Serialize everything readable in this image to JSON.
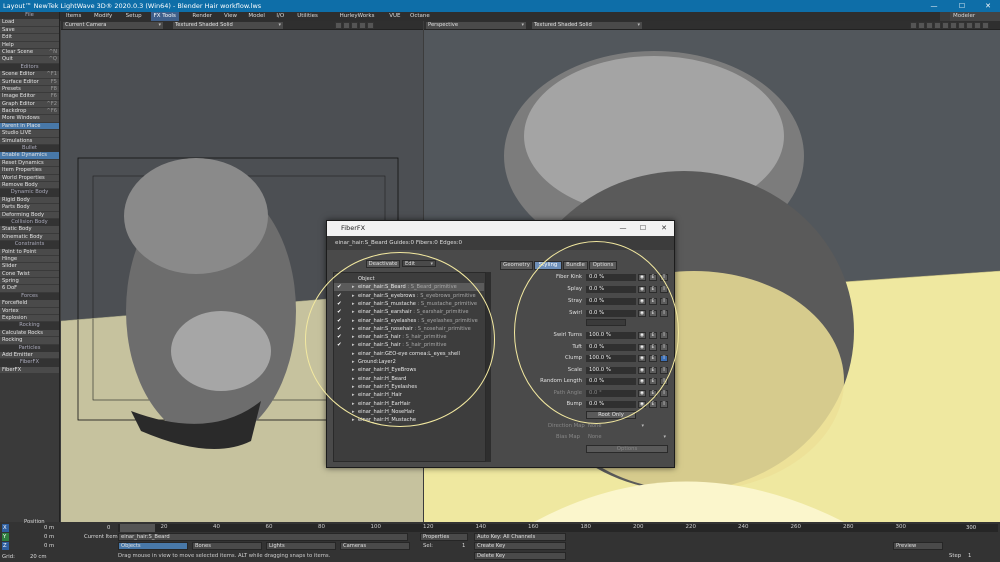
{
  "window": {
    "title": "Layout™ NewTek LightWave 3D® 2020.0.3 (Win64) - Blender Hair workflow.lws",
    "minimize": "—",
    "maximize": "☐",
    "close": "✕"
  },
  "menubar": {
    "items": [
      "Items",
      "Modify",
      "Setup",
      "FX Tools",
      "Render",
      "View",
      "Model",
      "I/O",
      "Utilities",
      "HurleyWorks",
      "VUE",
      "Octane"
    ],
    "active": "FX Tools",
    "modeler": "Modeler"
  },
  "sidebar": {
    "file_header": "File",
    "file_items": [
      {
        "label": "Load"
      },
      {
        "label": "Save"
      },
      {
        "label": "Edit"
      },
      {
        "label": "Help"
      }
    ],
    "clear_scene": {
      "label": "Clear Scene",
      "shortcut": "^N"
    },
    "quit": {
      "label": "Quit",
      "shortcut": "^Q"
    },
    "editors_header": "Editors",
    "editor_items": [
      {
        "label": "Scene Editor",
        "shortcut": "^F1"
      },
      {
        "label": "Surface Editor",
        "shortcut": "F5"
      },
      {
        "label": "Presets",
        "shortcut": "F8"
      },
      {
        "label": "Image Editor",
        "shortcut": "F6"
      },
      {
        "label": "Graph Editor",
        "shortcut": "^F2"
      },
      {
        "label": "Backdrop",
        "shortcut": "^F6"
      },
      {
        "label": "More Windows"
      }
    ],
    "extra_items": [
      {
        "label": "Parent in Place"
      },
      {
        "label": "Studio LIVE"
      },
      {
        "label": "Simulations"
      }
    ],
    "bullet_header": "Bullet",
    "bullet_items": [
      "Enable Dynamics",
      "Reset Dynamics",
      "Item Properties",
      "World Properties",
      "Remove Body"
    ],
    "dynamic_header": "Dynamic Body",
    "dynamic_items": [
      "Rigid Body",
      "Parts Body",
      "Deforming Body"
    ],
    "collision_header": "Collision Body",
    "collision_items": [
      "Static Body",
      "Kinematic Body"
    ],
    "constraints_header": "Constraints",
    "constraint_items": [
      "Point to Point",
      "Hinge",
      "Slider",
      "Cone Twist",
      "Spring",
      "6 DoF"
    ],
    "forces_header": "Forces",
    "force_items": [
      "Forcefield",
      "Vortex",
      "Explosion"
    ],
    "rocking_header": "Rocking",
    "rocking_items": [
      "Calculate Rocks",
      "Rocking"
    ],
    "particles_header": "Particles",
    "particle_items": [
      "Add Emitter"
    ],
    "fiberfx_header": "FiberFX",
    "fiberfx_items": [
      "FiberFX"
    ]
  },
  "viewport_left": {
    "camera": "Current Camera",
    "shading": "Textured Shaded Solid"
  },
  "viewport_right": {
    "view": "Perspective",
    "shading": "Textured Shaded Solid"
  },
  "fiberfx": {
    "title": "FiberFX",
    "info": "einar_hair:S_Beard Guides:0 Fibers:0 Edges:0",
    "deactivate": "Deactivate",
    "edit": "Edit",
    "tabs": [
      "Geometry",
      "Styling",
      "Bundle",
      "Options"
    ],
    "active_tab": "Styling",
    "tree": [
      {
        "check": "",
        "arrow": "",
        "name": "Object",
        "sub": ""
      },
      {
        "check": "✔",
        "arrow": "▸",
        "name": "einar_hair:S_Beard",
        "sub": " : S_Beard_primitive"
      },
      {
        "check": "✔",
        "arrow": "▸",
        "name": "einar_hair:S_eyebrows",
        "sub": " : S_eyebrows_primitive"
      },
      {
        "check": "✔",
        "arrow": "▸",
        "name": "einar_hair:S_mustache",
        "sub": " : S_mustache_primitive"
      },
      {
        "check": "✔",
        "arrow": "▸",
        "name": "einar_hair:S_earshair",
        "sub": " : S_earshair_primitive"
      },
      {
        "check": "✔",
        "arrow": "▸",
        "name": "einar_hair:S_eyelashes",
        "sub": " : S_eyelashes_primitive"
      },
      {
        "check": "✔",
        "arrow": "▸",
        "name": "einar_hair:S_nosehair",
        "sub": " : S_nosehair_primitive"
      },
      {
        "check": "✔",
        "arrow": "▸",
        "name": "einar_hair:S_hair",
        "sub": " : S_hair_primitive"
      },
      {
        "check": "✔",
        "arrow": "▸",
        "name": "einar_hair:S_hair",
        "sub": " : S_hair_primitive"
      },
      {
        "check": "",
        "arrow": "▸",
        "name": "einar_hair:GEO-eye cornea:L_eyes_shell",
        "sub": ""
      },
      {
        "check": "",
        "arrow": "▸",
        "name": "Ground:Layer2",
        "sub": ""
      },
      {
        "check": "",
        "arrow": "▸",
        "name": "einar_hair:H_EyeBrows",
        "sub": ""
      },
      {
        "check": "",
        "arrow": "▸",
        "name": "einar_hair:H_Beard",
        "sub": ""
      },
      {
        "check": "",
        "arrow": "▸",
        "name": "einar_hair:H_Eyelashes",
        "sub": ""
      },
      {
        "check": "",
        "arrow": "▸",
        "name": "einar_hair:H_Hair",
        "sub": ""
      },
      {
        "check": "",
        "arrow": "▸",
        "name": "einar_hair:H_EarHair",
        "sub": ""
      },
      {
        "check": "",
        "arrow": "▸",
        "name": "einar_hair:H_NoseHair",
        "sub": ""
      },
      {
        "check": "",
        "arrow": "▸",
        "name": "einar_hair:H_Mustache",
        "sub": ""
      }
    ],
    "params": [
      {
        "label": "Fiber Kink",
        "value": "0.0 %"
      },
      {
        "label": "Splay",
        "value": "0.0 %"
      },
      {
        "label": "Stray",
        "value": "0.0 %"
      },
      {
        "label": "Swirl",
        "value": "0.0 %"
      },
      {
        "label": "Swirl Turns",
        "value": "100.0 %"
      },
      {
        "label": "Tuft",
        "value": "0.0 %"
      },
      {
        "label": "Clump",
        "value": "100.0 %"
      },
      {
        "label": "Scale",
        "value": "100.0 %"
      },
      {
        "label": "Random Length",
        "value": "0.0 %"
      },
      {
        "label": "Path Angle",
        "value": "0.0 °"
      },
      {
        "label": "Bump",
        "value": "0.0 %"
      }
    ],
    "btn_e": "E",
    "btn_t": "T",
    "root_only": "Root Only",
    "direction_map": "Direction Map",
    "bias_map": "Bias Map",
    "none": "None",
    "options": "Options"
  },
  "timeline": {
    "ticks": [
      "0",
      "20",
      "40",
      "60",
      "80",
      "100",
      "120",
      "140",
      "160",
      "180",
      "200",
      "220",
      "240",
      "260",
      "280",
      "300"
    ],
    "end": "300",
    "current_frame": "0",
    "x_label": "X",
    "y_label": "Y",
    "z_label": "Z",
    "x_val": "0 m",
    "y_val": "0 m",
    "z_val": "0 m",
    "position": "Position",
    "grid_label": "Grid:",
    "grid_val": "20 cm",
    "current_item_label": "Current Item",
    "current_item": "einar_hair:S_Beard",
    "objects": "Objects",
    "bones": "Bones",
    "lights": "Lights",
    "cameras": "Cameras",
    "properties": "Properties",
    "sel_label": "Sel:",
    "sel_val": "1",
    "auto_key": "Auto Key: All Channels",
    "create_key": "Create Key",
    "delete_key": "Delete Key",
    "status": "Drag mouse in view to move selected items. ALT while dragging snaps to items.",
    "preview": "Preview",
    "step_label": "Step",
    "step_val": "1"
  }
}
